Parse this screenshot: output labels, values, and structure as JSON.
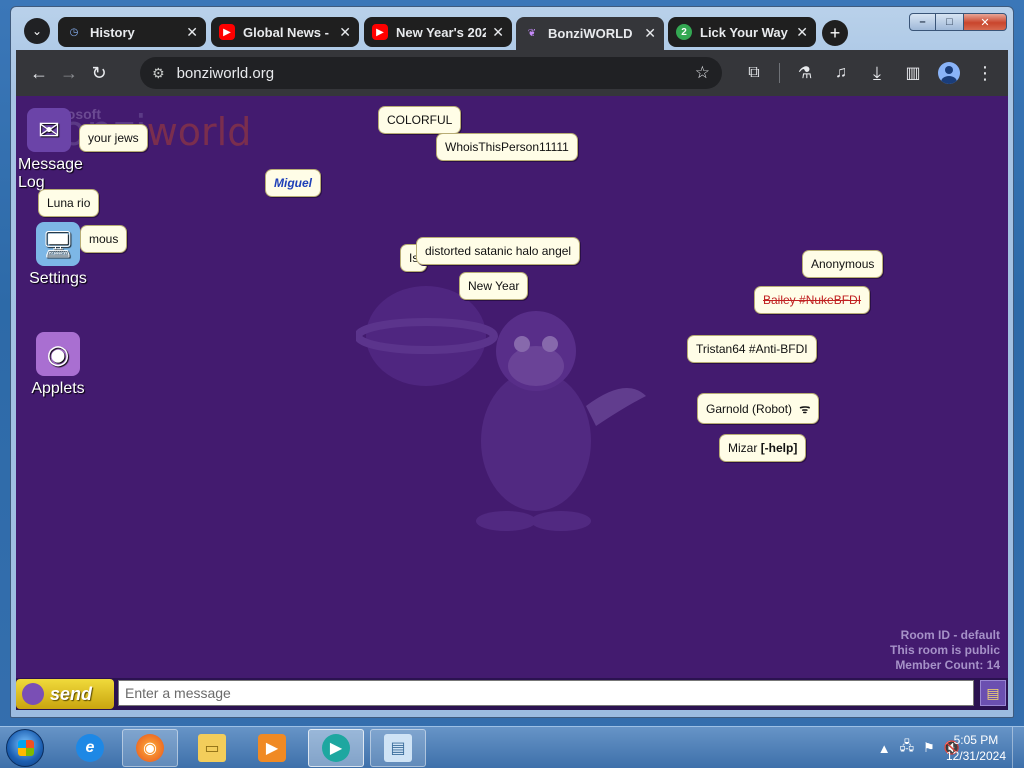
{
  "window": {
    "min": "–",
    "max": "□",
    "close": "✕"
  },
  "tabs": [
    {
      "title": "History",
      "favicon": "history-icon",
      "active": false
    },
    {
      "title": "Global News -",
      "favicon": "youtube-icon",
      "active": false
    },
    {
      "title": "New Year's 202",
      "favicon": "youtube-icon",
      "active": false
    },
    {
      "title": "BonziWORLD",
      "favicon": "bonzi-icon",
      "active": true
    },
    {
      "title": "Lick Your Way",
      "favicon": "lick-icon",
      "active": false
    }
  ],
  "toolbar": {
    "url": "bonziworld.org"
  },
  "page": {
    "logo_small": "Microsoft",
    "logo_main": "bonzi",
    "logo_world": "world",
    "desktop_icons": [
      {
        "label": "Message Log",
        "icon": "message-log-icon"
      },
      {
        "label": "Settings",
        "icon": "settings-icon"
      },
      {
        "label": "Applets",
        "icon": "applets-icon"
      }
    ],
    "bubbles": [
      "your jews",
      "Luna rio",
      "mous",
      "COLORFUL",
      "WhoisThisPerson11111",
      "Miguel",
      "Is",
      "distorted satanic halo angel",
      "New Year",
      "Anonymous",
      "Bailey #NukeBFDI",
      "Tristan64 #Anti-BFDI",
      "Garnold (Robot)",
      "Mizar",
      "[-help]"
    ],
    "room": {
      "id": "Room ID - default",
      "public": "This room is public",
      "members": "Member Count: 14"
    },
    "chat": {
      "send_label": "send",
      "placeholder": "Enter a message"
    }
  },
  "taskbar": {
    "items": [
      "internet-explorer-icon",
      "firefox-icon",
      "explorer-folder-icon",
      "media-player-icon",
      "chrome-app-icon",
      "notepad-icon"
    ],
    "clock_time": "5:05 PM",
    "clock_date": "12/31/2024"
  },
  "colors": {
    "room_bg": "#431b6f",
    "bubble_bg": "#fffde7",
    "send_yellow": "#f0da3b"
  }
}
